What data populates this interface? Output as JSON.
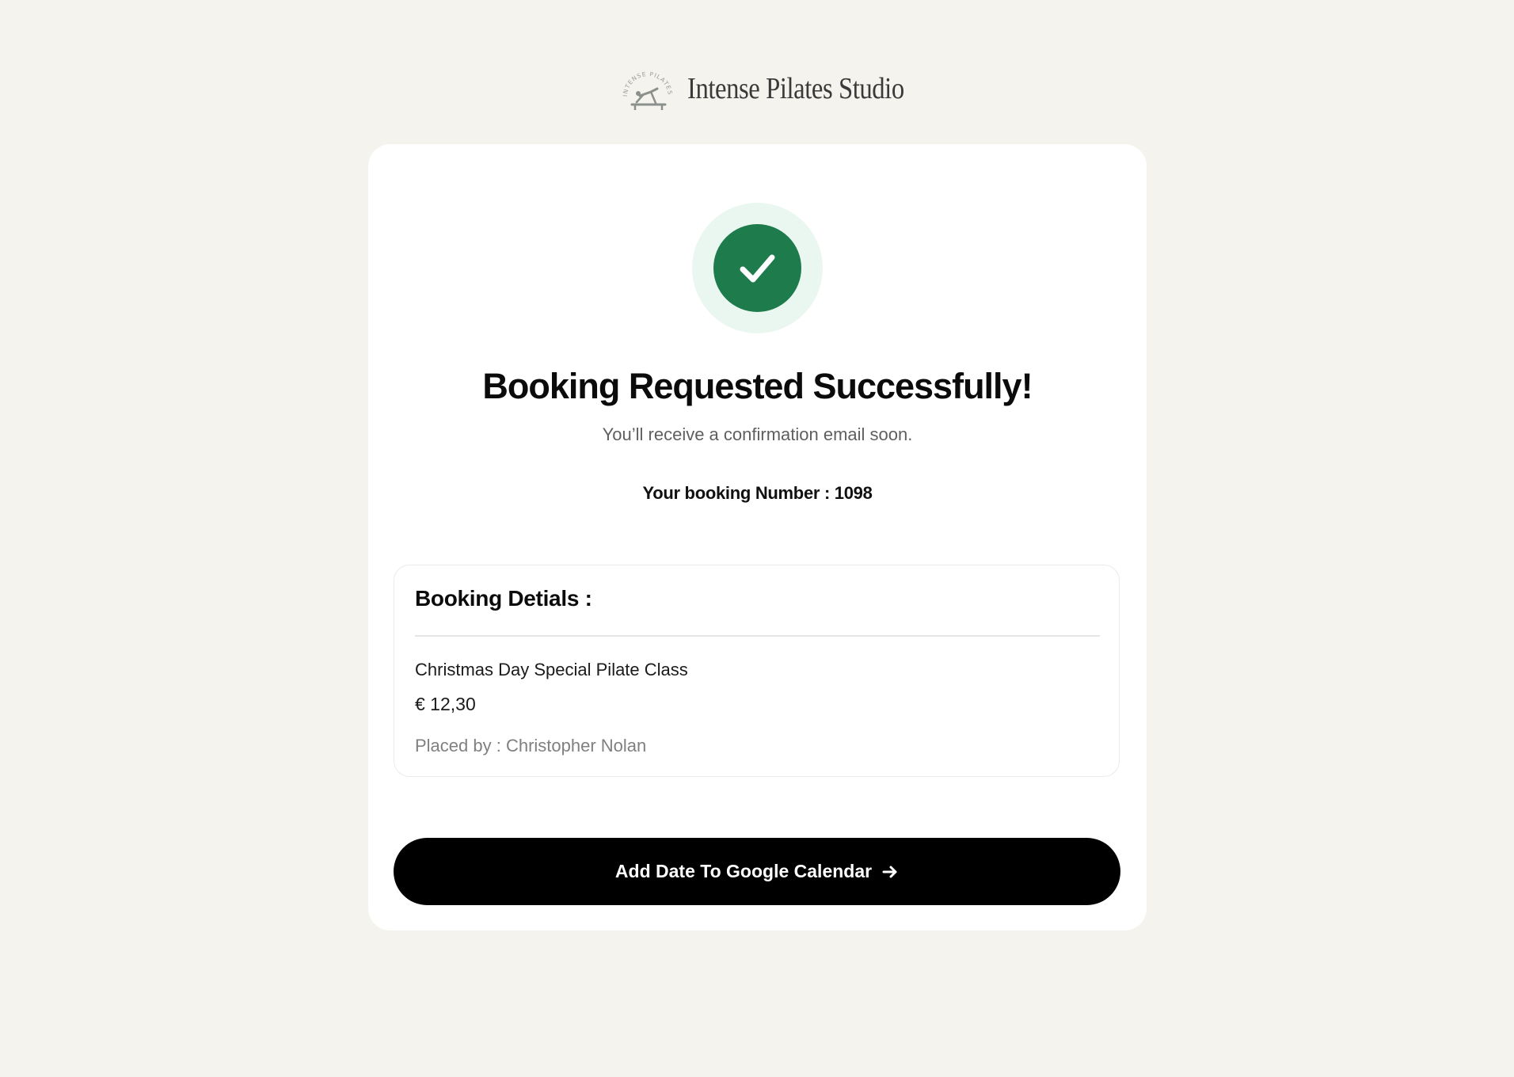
{
  "brand": {
    "name": "Intense Pilates Studio",
    "logo_text": "INTENSE PILATES STUDIO",
    "logo_icon": "pilates-reformer-logo"
  },
  "confirmation": {
    "icon": "check-icon",
    "title": "Booking Requested Successfully!",
    "subtitle": "You’ll receive a confirmation email soon.",
    "booking_number_label": "Your booking Number : 1098"
  },
  "details": {
    "title": "Booking Detials :",
    "class_name": "Christmas Day Special Pilate Class",
    "price": "€ 12,30",
    "placed_by": "Placed by : Christopher Nolan"
  },
  "actions": {
    "calendar_label": "Add Date To Google Calendar",
    "calendar_icon": "arrow-right-icon"
  },
  "colors": {
    "page_background": "#f4f3ee",
    "card_background": "#ffffff",
    "success_green": "#1e7c4c",
    "success_halo": "#eaf7f0",
    "button_background": "#000000"
  }
}
